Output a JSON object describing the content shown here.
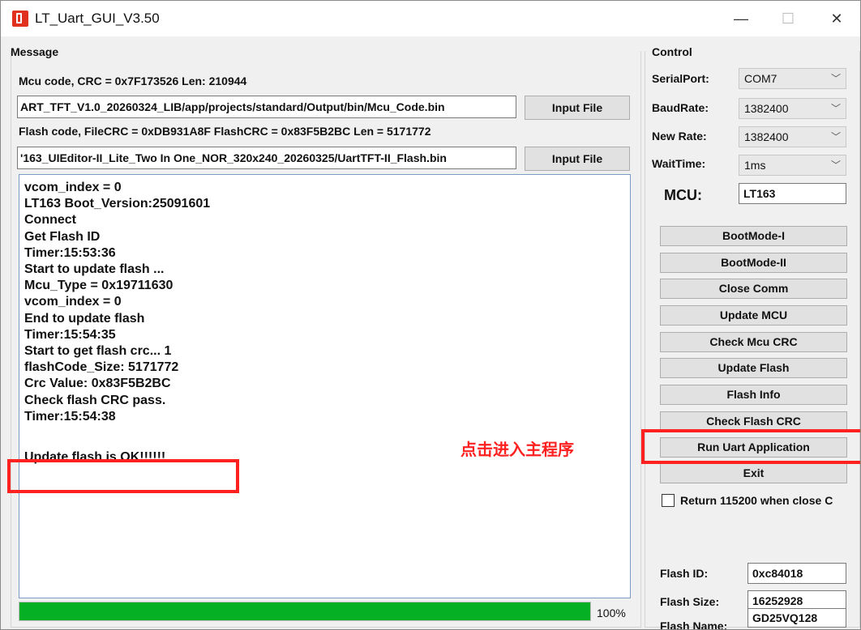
{
  "window": {
    "title": "LT_Uart_GUI_V3.50",
    "minimize": "—",
    "maximize": "☐",
    "close": "✕"
  },
  "message": {
    "group_title": "Message",
    "mcu_code_label": "Mcu code, CRC = 0x7F173526 Len: 210944",
    "mcu_path": "ART_TFT_V1.0_20260324_LIB/app/projects/standard/Output/bin/Mcu_Code.bin",
    "mcu_input_button": "Input File",
    "flash_code_label": "Flash code, FileCRC = 0xDB931A8F  FlashCRC = 0x83F5B2BC  Len = 5171772",
    "flash_path": "'163_UIEditor-II_Lite_Two In One_NOR_320x240_20260325/UartTFT-II_Flash.bin",
    "flash_input_button": "Input File",
    "log": [
      "vcom_index = 0",
      "LT163 Boot_Version:25091601",
      "Connect",
      "Get Flash ID",
      "Timer:15:53:36",
      "Start to update flash ...",
      "Mcu_Type = 0x19711630",
      "vcom_index = 0",
      "End to update flash",
      "Timer:15:54:35",
      "Start to get flash crc... 1",
      "flashCode_Size: 5171772",
      "Crc Value: 0x83F5B2BC",
      "Check flash CRC pass.",
      "Timer:15:54:38",
      "",
      "Update flash is OK!!!!!!"
    ],
    "progress_value": 1.0,
    "progress_text": "100%"
  },
  "control": {
    "group_title": "Control",
    "serial_port_label": "SerialPort:",
    "serial_port_value": "COM7",
    "baud_rate_label": "BaudRate:",
    "baud_rate_value": "1382400",
    "new_rate_label": "New Rate:",
    "new_rate_value": "1382400",
    "wait_time_label": "WaitTime:",
    "wait_time_value": "1ms",
    "mcu_label": "MCU:",
    "mcu_value": "LT163",
    "chevron": "﹀",
    "buttons": [
      "BootMode-I",
      "BootMode-II",
      "Close Comm",
      "Update MCU",
      "Check Mcu CRC",
      "Update Flash",
      "Flash Info",
      "Check Flash CRC",
      "Run Uart Application",
      "Exit"
    ],
    "return_checkbox_label": "Return 115200 when close C",
    "flash_id_label": "Flash ID:",
    "flash_id_value": "0xc84018",
    "flash_size_label": "Flash Size:",
    "flash_size_value": "16252928",
    "flash_name_label": "Flash Name:",
    "flash_name_value": "GD25VQ128"
  },
  "annotation": {
    "text": "点击进入主程序",
    "color": "#ff2020"
  },
  "colors": {
    "progress": "#06b025",
    "highlight": "#ff2020"
  }
}
